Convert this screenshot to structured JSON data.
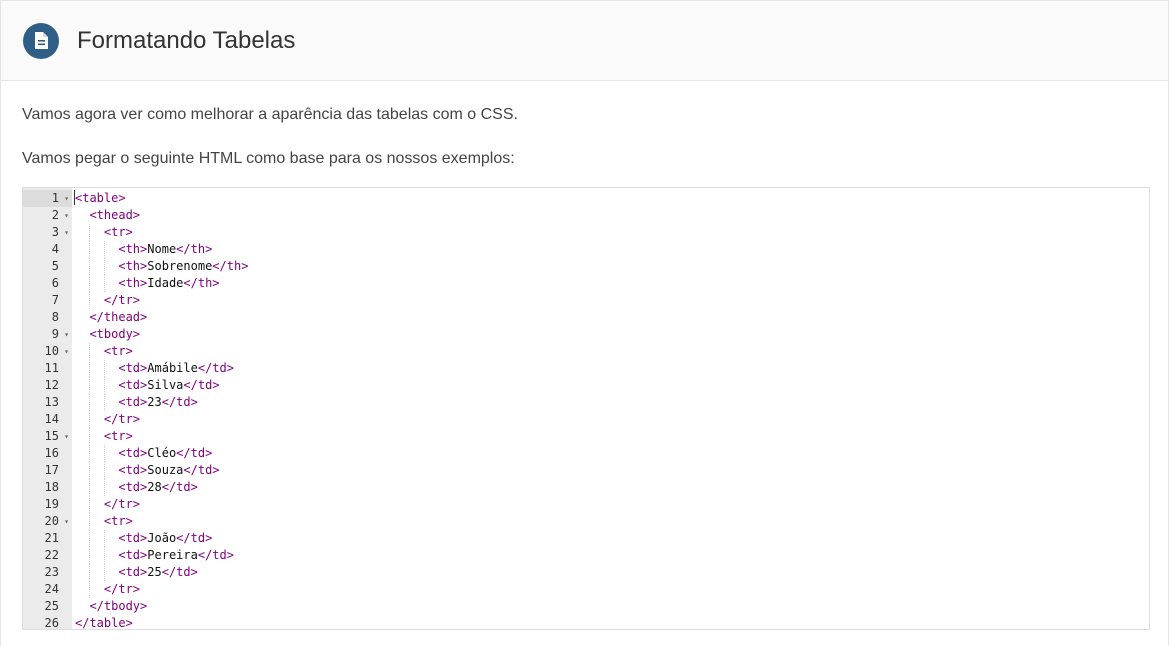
{
  "header": {
    "title": "Formatando Tabelas",
    "icon": "document-icon",
    "icon_color": "#2f5f86"
  },
  "paragraphs": [
    "Vamos agora ver como melhorar a aparência das tabelas com o CSS.",
    "Vamos pegar o seguinte HTML como base para os nossos exemplos:"
  ],
  "editor": {
    "tag_color": "#800080",
    "lines": [
      {
        "num": "1",
        "fold": true,
        "indent": 0,
        "open": "<table>",
        "text": "",
        "close": ""
      },
      {
        "num": "2",
        "fold": true,
        "indent": 1,
        "open": "<thead>",
        "text": "",
        "close": ""
      },
      {
        "num": "3",
        "fold": true,
        "indent": 2,
        "open": "<tr>",
        "text": "",
        "close": ""
      },
      {
        "num": "4",
        "fold": false,
        "indent": 3,
        "open": "<th>",
        "text": "Nome",
        "close": "</th>"
      },
      {
        "num": "5",
        "fold": false,
        "indent": 3,
        "open": "<th>",
        "text": "Sobrenome",
        "close": "</th>"
      },
      {
        "num": "6",
        "fold": false,
        "indent": 3,
        "open": "<th>",
        "text": "Idade",
        "close": "</th>"
      },
      {
        "num": "7",
        "fold": false,
        "indent": 2,
        "open": "</tr>",
        "text": "",
        "close": ""
      },
      {
        "num": "8",
        "fold": false,
        "indent": 1,
        "open": "</thead>",
        "text": "",
        "close": ""
      },
      {
        "num": "9",
        "fold": true,
        "indent": 1,
        "open": "<tbody>",
        "text": "",
        "close": ""
      },
      {
        "num": "10",
        "fold": true,
        "indent": 2,
        "open": "<tr>",
        "text": "",
        "close": ""
      },
      {
        "num": "11",
        "fold": false,
        "indent": 3,
        "open": "<td>",
        "text": "Amábile",
        "close": "</td>"
      },
      {
        "num": "12",
        "fold": false,
        "indent": 3,
        "open": "<td>",
        "text": "Silva",
        "close": "</td>"
      },
      {
        "num": "13",
        "fold": false,
        "indent": 3,
        "open": "<td>",
        "text": "23",
        "close": "</td>"
      },
      {
        "num": "14",
        "fold": false,
        "indent": 2,
        "open": "</tr>",
        "text": "",
        "close": ""
      },
      {
        "num": "15",
        "fold": true,
        "indent": 2,
        "open": "<tr>",
        "text": "",
        "close": ""
      },
      {
        "num": "16",
        "fold": false,
        "indent": 3,
        "open": "<td>",
        "text": "Cléo",
        "close": "</td>"
      },
      {
        "num": "17",
        "fold": false,
        "indent": 3,
        "open": "<td>",
        "text": "Souza",
        "close": "</td>"
      },
      {
        "num": "18",
        "fold": false,
        "indent": 3,
        "open": "<td>",
        "text": "28",
        "close": "</td>"
      },
      {
        "num": "19",
        "fold": false,
        "indent": 2,
        "open": "</tr>",
        "text": "",
        "close": ""
      },
      {
        "num": "20",
        "fold": true,
        "indent": 2,
        "open": "<tr>",
        "text": "",
        "close": ""
      },
      {
        "num": "21",
        "fold": false,
        "indent": 3,
        "open": "<td>",
        "text": "João",
        "close": "</td>"
      },
      {
        "num": "22",
        "fold": false,
        "indent": 3,
        "open": "<td>",
        "text": "Pereira",
        "close": "</td>"
      },
      {
        "num": "23",
        "fold": false,
        "indent": 3,
        "open": "<td>",
        "text": "25",
        "close": "</td>"
      },
      {
        "num": "24",
        "fold": false,
        "indent": 2,
        "open": "</tr>",
        "text": "",
        "close": ""
      },
      {
        "num": "25",
        "fold": false,
        "indent": 1,
        "open": "</tbody>",
        "text": "",
        "close": ""
      },
      {
        "num": "26",
        "fold": false,
        "indent": 0,
        "open": "</table>",
        "text": "",
        "close": ""
      }
    ]
  }
}
